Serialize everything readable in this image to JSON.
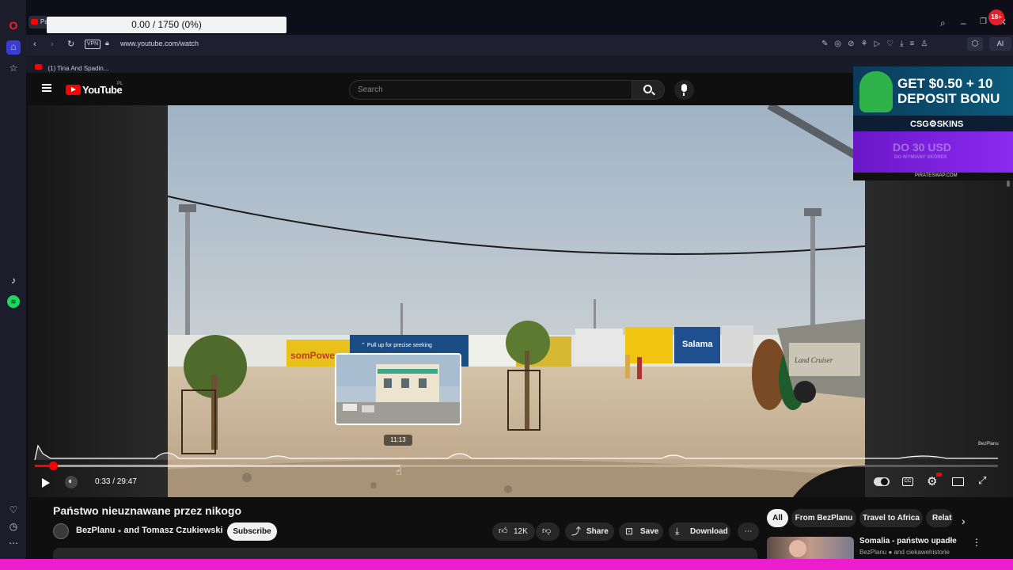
{
  "browser": {
    "counter": "0.00 / 1750 (0%)",
    "url": "www.youtube.com/watch",
    "vpn_label": "VPN",
    "bookmark_label": "(1) Tina And Spadin...",
    "ai_label": "AI",
    "tab_fragment": "Pa",
    "badge": "18+"
  },
  "youtube": {
    "logo_text": "YouTube",
    "logo_region": "PL",
    "search_placeholder": "Search"
  },
  "player": {
    "seek_hint": "Pull up for precise seeking",
    "preview_time": "11:13",
    "time": "0:33 / 29:47",
    "watermark": "BezPlanu",
    "progress": 0.019,
    "hover_position": 0.38,
    "video_signs": {
      "sign1": "somPower",
      "sign2": "Salama",
      "sign3": "Land Cruiser"
    }
  },
  "video": {
    "title": "Państwo nieuznawane przez nikogo",
    "channel": "BezPlanu",
    "collab": "and Tomasz Czukiewski",
    "subscribe": "Subscribe",
    "likes": "12K",
    "share": "Share",
    "save": "Save",
    "download": "Download"
  },
  "chips": [
    "All",
    "From BezPlanu",
    "Travel to Africa",
    "Relat"
  ],
  "recommendation": {
    "title": "Somalia - państwo upadłe",
    "channel": "BezPlanu",
    "collab": "and ciekawehistorie"
  },
  "ad": {
    "line1": "GET $0.50 + 10",
    "line2": "DEPOSIT BONU",
    "brand": "CSG⚙SKINS",
    "promo": "DO 30 USD",
    "promo_sub": "DO WYMIANY SKÓREK",
    "site": "PIRATESWAP.COM"
  },
  "colors": {
    "youtube_red": "#ff0000",
    "sidebar_bg": "#1c1d2b",
    "magenta": "#ec1dcd",
    "ad_purple": "#7a1ed6"
  }
}
